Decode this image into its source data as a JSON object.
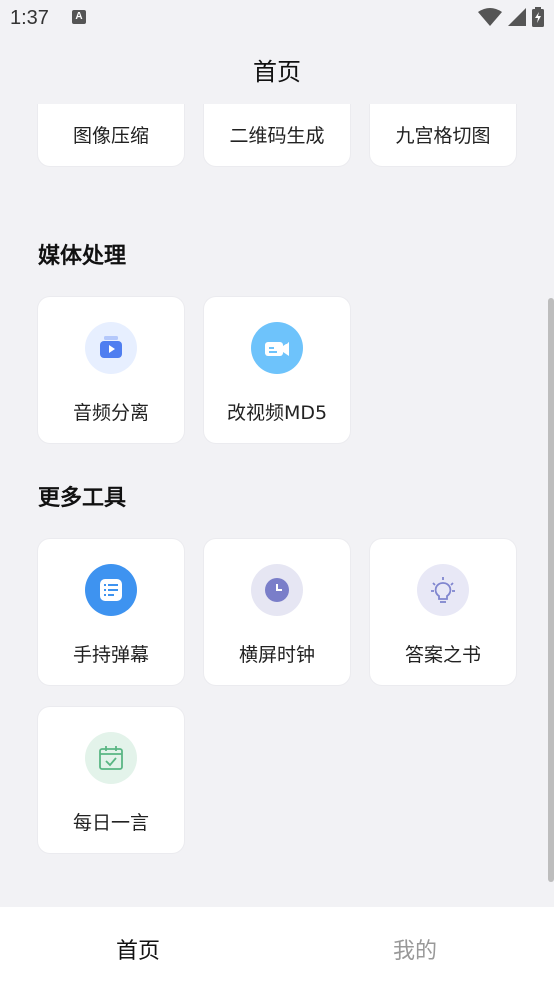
{
  "status_bar": {
    "time": "1:37",
    "notification_icon": "A"
  },
  "header": {
    "title": "首页"
  },
  "sections": {
    "image": {
      "items": [
        {
          "label": "图像压缩",
          "icon": "zip-icon",
          "bg": "#ece9fb"
        },
        {
          "label": "二维码生成",
          "icon": "qrcode-icon",
          "bg": "#e6f6ec"
        },
        {
          "label": "九宫格切图",
          "icon": "grid-icon",
          "bg": "#e9eefb"
        }
      ]
    },
    "media": {
      "title": "媒体处理",
      "items": [
        {
          "label": "音频分离",
          "icon": "video-icon",
          "bg": "#e7efff"
        },
        {
          "label": "改视频MD5",
          "icon": "camera-icon",
          "bg": "#6ec3fb"
        }
      ]
    },
    "more": {
      "title": "更多工具",
      "items": [
        {
          "label": "手持弹幕",
          "icon": "list-icon",
          "bg": "#3e93f0"
        },
        {
          "label": "横屏时钟",
          "icon": "clock-icon",
          "bg": "#e6e6f3"
        },
        {
          "label": "答案之书",
          "icon": "bulb-icon",
          "bg": "#e8e8f6"
        },
        {
          "label": "每日一言",
          "icon": "calendar-icon",
          "bg": "#e3f3ea"
        }
      ]
    }
  },
  "bottom_nav": {
    "home": "首页",
    "mine": "我的"
  }
}
